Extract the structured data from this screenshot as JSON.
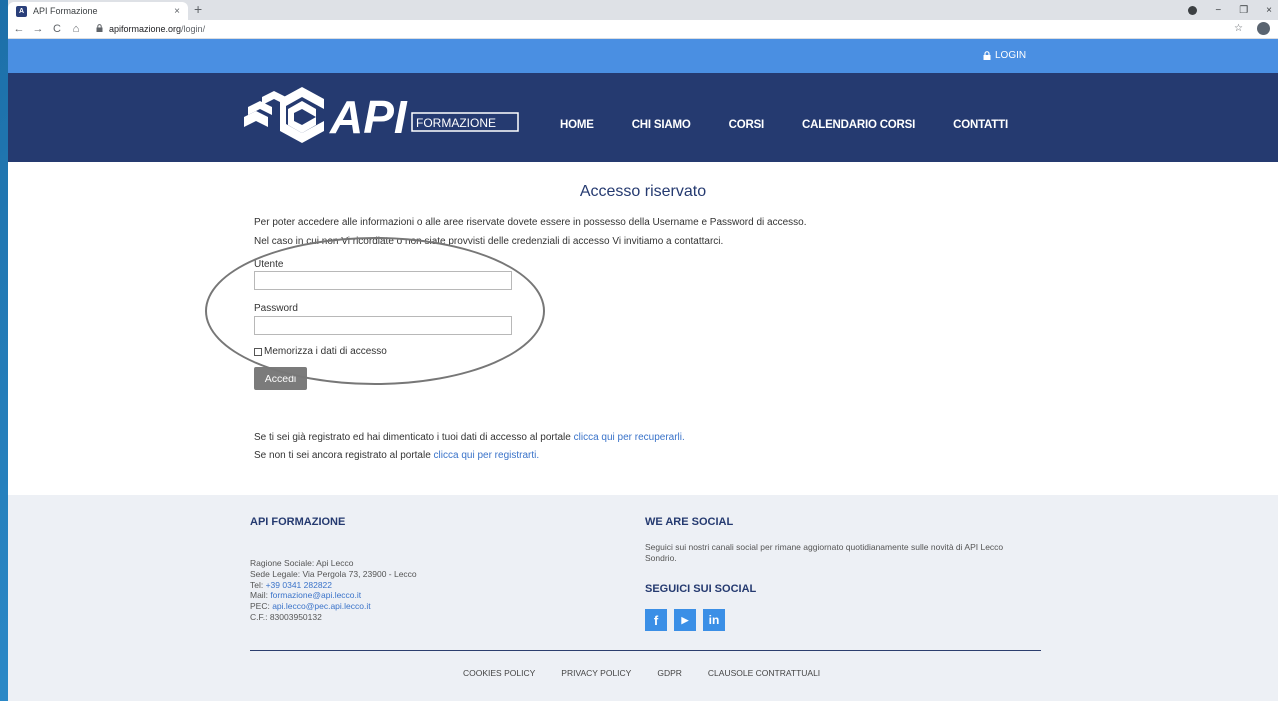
{
  "browser": {
    "tab_title": "API Formazione",
    "tab_close": "×",
    "new_tab": "+",
    "url_host": "apiformazione.org",
    "url_path": "/login/",
    "nav_back": "←",
    "nav_forward": "→",
    "nav_reload": "C",
    "nav_home": "⌂",
    "lock": "🔒",
    "star": "☆",
    "win_minimize": "−",
    "win_restore": "❐",
    "win_close": "×"
  },
  "topbar": {
    "login_label": "LOGIN",
    "login_icon": "lock-icon"
  },
  "header": {
    "logo_text": "API",
    "logo_sub": "FORMAZIONE",
    "nav": [
      "HOME",
      "CHI SIAMO",
      "CORSI",
      "CALENDARIO CORSI",
      "CONTATTI"
    ]
  },
  "main": {
    "title": "Accesso riservato",
    "intro_1": "Per poter accedere alle informazioni o alle aree riservate dovete essere in possesso della Username e Password di accesso.",
    "intro_2": "Nel caso in cui non Vi ricordiate o non siate provvisti delle credenziali di accesso Vi invitiamo a contattarci.",
    "user_label": "Utente",
    "user_value": "",
    "password_label": "Password",
    "password_value": "",
    "remember_label": "Memorizza i dati di accesso",
    "submit_label": "Accedi",
    "recover_text": "Se ti sei già registrato ed hai dimenticato i tuoi dati di accesso al portale ",
    "recover_link": "clicca qui per recuperarli.",
    "register_text": "Se non ti sei ancora registrato al portale ",
    "register_link": "clicca qui per registrarti."
  },
  "footer": {
    "col1_title": "API FORMAZIONE",
    "ragione": "Ragione Sociale: Api Lecco",
    "sede": "Sede Legale: Via Pergola 73, 23900 - Lecco",
    "tel_label": "Tel: ",
    "tel_value": "+39 0341 282822",
    "mail_label": "Mail: ",
    "mail_value": "formazione@api.lecco.it",
    "pec_label": "PEC: ",
    "pec_value": "api.lecco@pec.api.lecco.it",
    "cf": "C.F.: 83003950132",
    "col2_title": "WE ARE SOCIAL",
    "social_text": "Seguici sui nostri canali social per rimane aggiornato quotidianamente sulle novità di API Lecco Sondrio.",
    "social_title": "SEGUICI SUI SOCIAL",
    "social_icons": [
      {
        "name": "facebook-icon",
        "glyph": "f"
      },
      {
        "name": "youtube-icon",
        "glyph": "▶"
      },
      {
        "name": "linkedin-icon",
        "glyph": "in"
      }
    ],
    "links": [
      "COOKIES POLICY",
      "PRIVACY POLICY",
      "GDPR",
      "CLAUSOLE CONTRATTUALI"
    ]
  },
  "colors": {
    "header_bg": "#253a70",
    "topbar_bg": "#4a8fe2",
    "link": "#3a73c9",
    "button": "#7b7b7b"
  }
}
